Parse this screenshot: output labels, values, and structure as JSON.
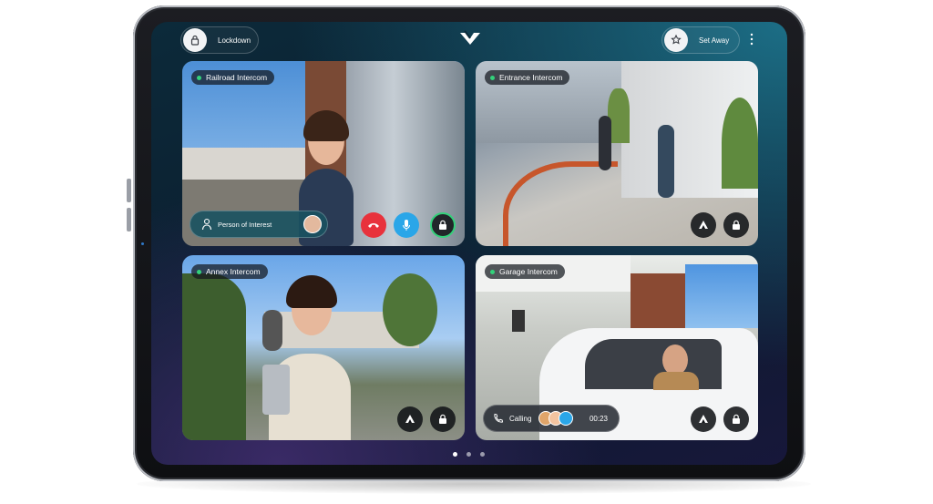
{
  "topbar": {
    "lockdown_label": "Lockdown",
    "set_away_label": "Set Away",
    "lock_icon": "lock-icon",
    "logo_icon": "verkada-logo-icon",
    "away_icon": "away-icon",
    "menu_icon": "kebab-menu-icon"
  },
  "tiles": [
    {
      "name": "Railroad Intercom",
      "status_color": "#33d17a",
      "banner": {
        "label": "Person of Interest"
      },
      "actions": [
        "end-call",
        "microphone",
        "unlock"
      ]
    },
    {
      "name": "Entrance Intercom",
      "status_color": "#33d17a",
      "actions": [
        "alert",
        "unlock"
      ]
    },
    {
      "name": "Annex Intercom",
      "status_color": "#33d17a",
      "actions": [
        "alert",
        "unlock"
      ]
    },
    {
      "name": "Garage Intercom",
      "status_color": "#33d17a",
      "calling": {
        "label": "Calling",
        "timer": "00:23"
      },
      "actions": [
        "alert",
        "unlock"
      ]
    }
  ],
  "colors": {
    "end_call": "#e8323c",
    "mic": "#2aa6e8",
    "unlock_ring": "#33d17a"
  },
  "pager": {
    "pages": 3,
    "current": 1
  }
}
